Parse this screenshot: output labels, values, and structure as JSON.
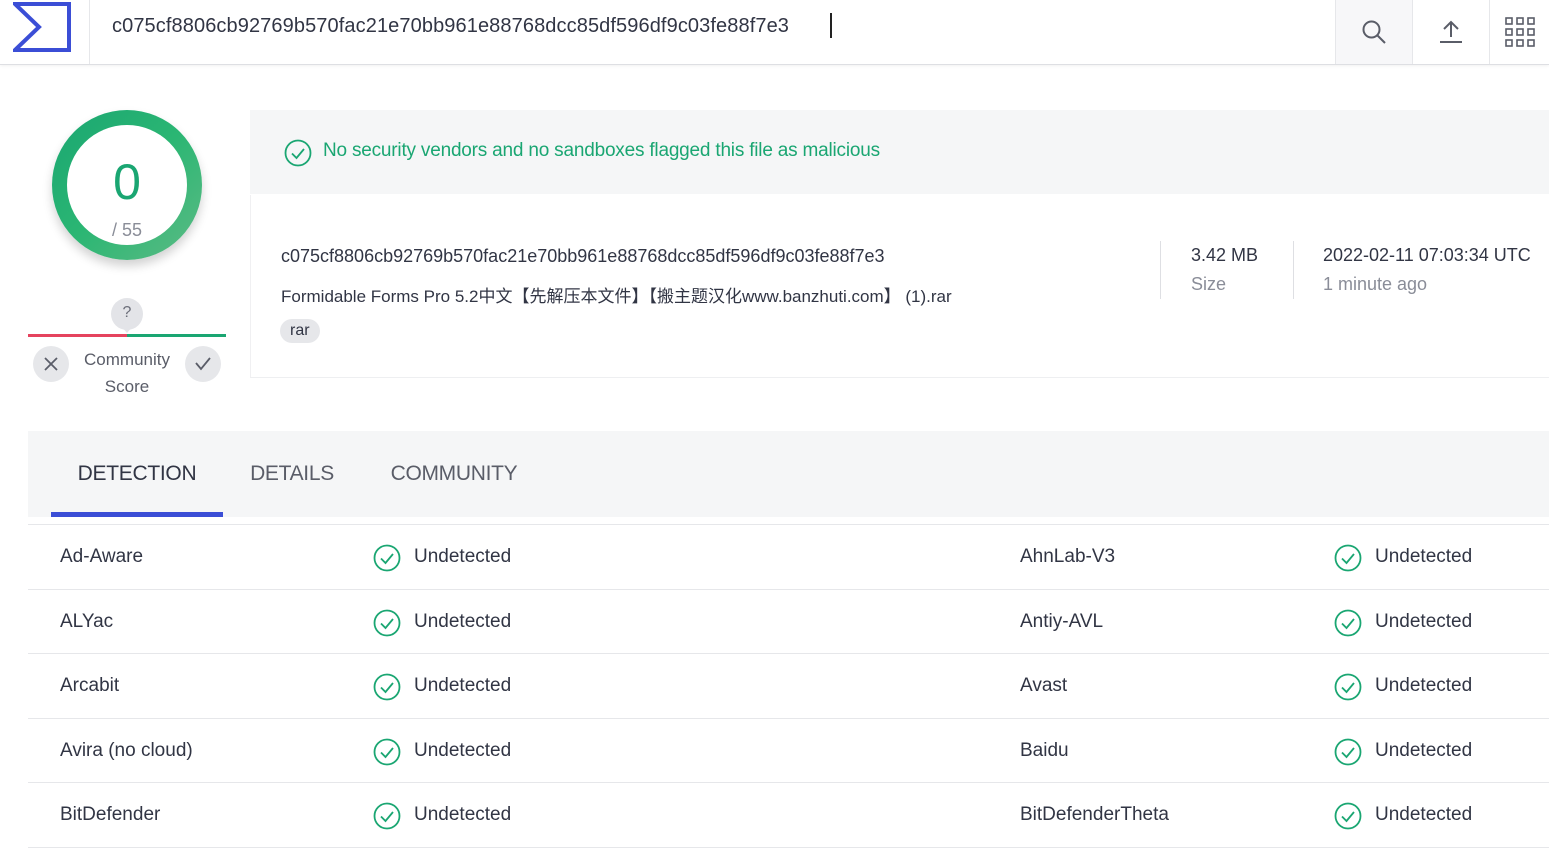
{
  "header": {
    "logo_icon": "virustotal-sigma-logo-icon",
    "search_value": "c075cf8806cb92769b570fac21e70bb961e88768dcc85df596df9c03fe88f7e3",
    "search_icon": "search-icon",
    "upload_icon": "upload-icon",
    "apps_icon": "apps-grid-icon"
  },
  "score": {
    "detections": "0",
    "total": "/ 55",
    "ring_color": "#1aa672"
  },
  "community": {
    "question": "?",
    "label": "Community Score",
    "colors": {
      "negative": "#e5435e",
      "positive": "#1aa672"
    }
  },
  "verdict": {
    "text": "No security vendors and no sandboxes flagged this file as malicious",
    "color": "#1aa672"
  },
  "file": {
    "hash": "c075cf8806cb92769b570fac21e70bb961e88768dcc85df596df9c03fe88f7e3",
    "name": "Formidable Forms Pro 5.2中文【先解压本文件】【搬主题汉化www.banzhuti.com】 (1).rar",
    "tag": "rar",
    "size_value": "3.42 MB",
    "size_label": "Size",
    "date_value": "2022-02-11 07:03:34 UTC",
    "date_label": "1 minute ago"
  },
  "tabs": [
    {
      "label": "DETECTION",
      "active": true
    },
    {
      "label": "DETAILS",
      "active": false
    },
    {
      "label": "COMMUNITY",
      "active": false
    }
  ],
  "detections": [
    {
      "left_vendor": "Ad-Aware",
      "left_result": "Undetected",
      "right_vendor": "AhnLab-V3",
      "right_result": "Undetected"
    },
    {
      "left_vendor": "ALYac",
      "left_result": "Undetected",
      "right_vendor": "Antiy-AVL",
      "right_result": "Undetected"
    },
    {
      "left_vendor": "Arcabit",
      "left_result": "Undetected",
      "right_vendor": "Avast",
      "right_result": "Undetected"
    },
    {
      "left_vendor": "Avira (no cloud)",
      "left_result": "Undetected",
      "right_vendor": "Baidu",
      "right_result": "Undetected"
    },
    {
      "left_vendor": "BitDefender",
      "left_result": "Undetected",
      "right_vendor": "BitDefenderTheta",
      "right_result": "Undetected"
    }
  ],
  "accent_color": "#3b4ed6"
}
